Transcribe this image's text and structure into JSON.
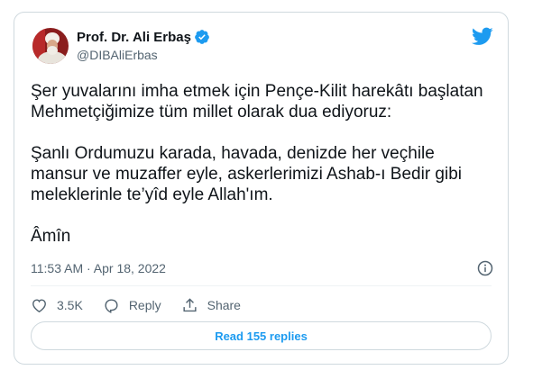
{
  "author": {
    "name": "Prof. Dr. Ali Erbaş",
    "handle": "@DIBAliErbas"
  },
  "tweet": {
    "paragraphs": [
      "Şer yuvalarını imha etmek için Pençe-Kilit harekâtı başlatan Mehmetçiğimize tüm millet olarak dua ediyoruz:",
      "Şanlı Ordumuzu karada, havada, denizde her veçhile mansur ve muzaffer eyle, askerlerimizi Ashab-ı Bedir gibi meleklerinle te’yîd eyle Allah'ım.",
      "Âmîn"
    ],
    "timestamp": "11:53 AM · Apr 18, 2022"
  },
  "actions": {
    "like_count": "3.5K",
    "reply_label": "Reply",
    "share_label": "Share"
  },
  "replies_button_label": "Read 155 replies",
  "icons": {
    "verified": "verified-badge-icon",
    "brand": "twitter-bird-icon",
    "info": "info-icon",
    "like": "heart-icon",
    "reply": "speech-bubble-icon",
    "share": "share-upload-icon"
  },
  "colors": {
    "accent": "#1d9bf0",
    "text": "#0f1419",
    "muted": "#536471",
    "border": "#cfd9de"
  }
}
